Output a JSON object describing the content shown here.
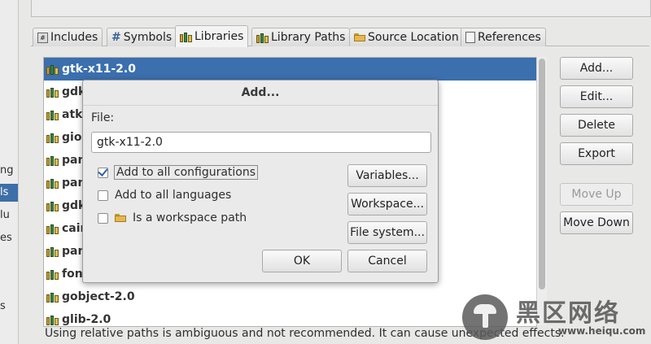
{
  "sidebar_fragments": [
    "ng",
    "ls",
    "lu",
    "es",
    "s"
  ],
  "tabs": [
    {
      "label": "Includes",
      "icon": "includes-icon"
    },
    {
      "label": "Symbols",
      "icon": "hash-icon"
    },
    {
      "label": "Libraries",
      "icon": "library-icon",
      "active": true
    },
    {
      "label": "Library Paths",
      "icon": "library-paths-icon"
    },
    {
      "label": "Source Location",
      "icon": "source-folder-icon"
    },
    {
      "label": "References",
      "icon": "references-icon"
    }
  ],
  "libraries": [
    "gtk-x11-2.0",
    "gdk",
    "atk-",
    "gio-",
    "pan",
    "pan",
    "gdk",
    "cair",
    "pan",
    "fon",
    "gobject-2.0",
    "glib-2.0"
  ],
  "selected_library": "gtk-x11-2.0",
  "right_buttons": [
    {
      "label": "Add...",
      "enabled": true
    },
    {
      "label": "Edit...",
      "enabled": true
    },
    {
      "label": "Delete",
      "enabled": true
    },
    {
      "label": "Export",
      "enabled": true
    },
    {
      "label": "Move Up",
      "enabled": false
    },
    {
      "label": "Move Down",
      "enabled": true
    }
  ],
  "status_text": "Using relative paths is ambiguous and not recommended. It can cause unexpected effects.",
  "dialog": {
    "title": "Add...",
    "file_label": "File:",
    "file_value": "gtk-x11-2.0",
    "checkboxes": [
      {
        "label": "Add to all configurations",
        "checked": true
      },
      {
        "label": "Add to all languages",
        "checked": false
      },
      {
        "label": "Is a workspace path",
        "checked": false
      }
    ],
    "variables_button": "Variables...",
    "workspace_button": "Workspace...",
    "filesystem_button": "File system...",
    "ok_button": "OK",
    "cancel_button": "Cancel"
  },
  "watermark": {
    "chinese": "黑区网络",
    "url": "www.heiqu.com"
  }
}
